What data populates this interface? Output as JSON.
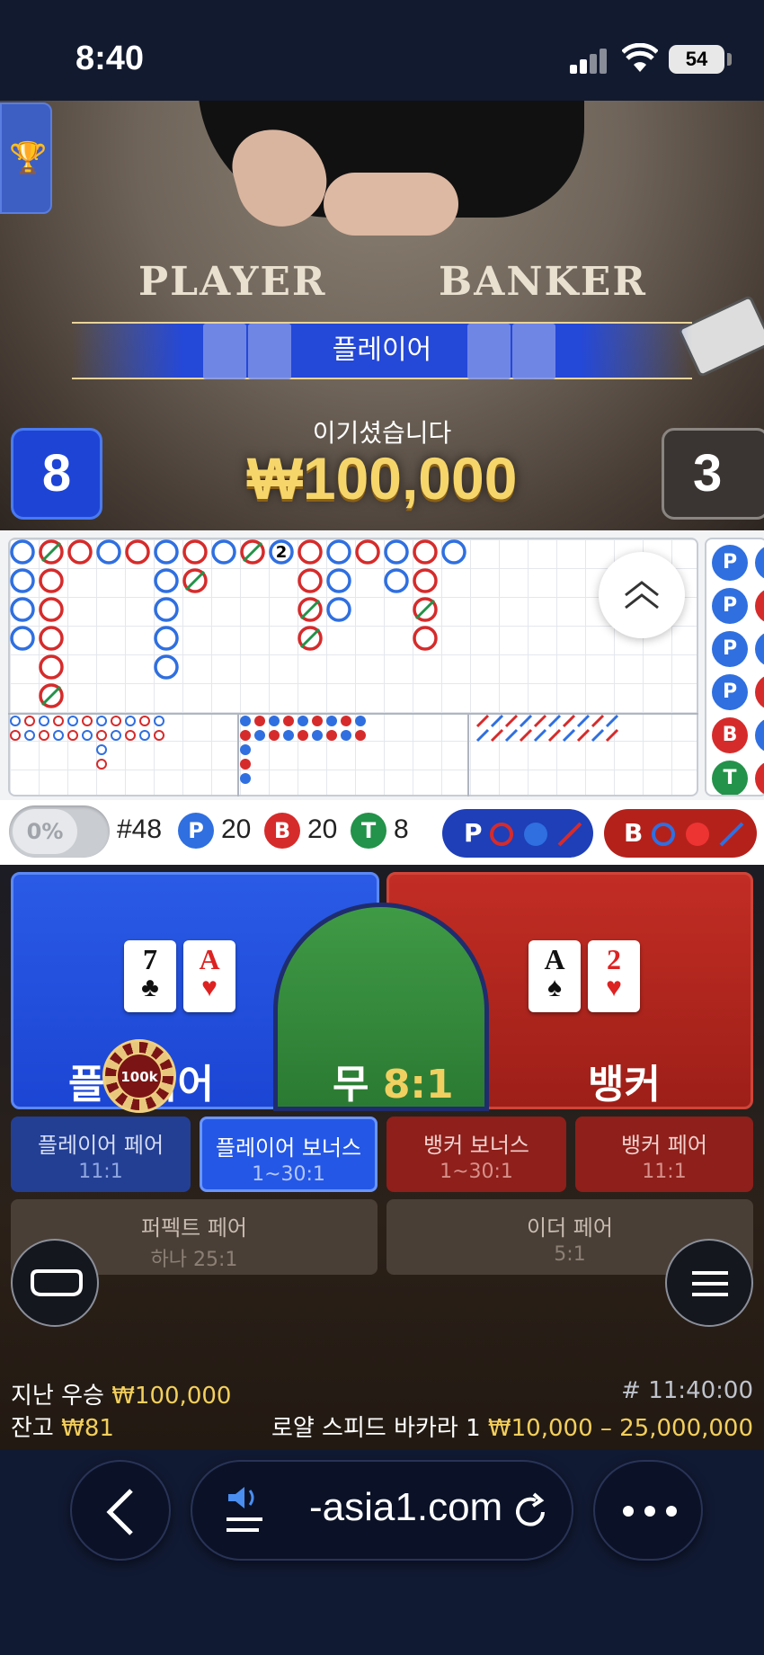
{
  "status": {
    "time": "8:40",
    "battery": "54"
  },
  "video": {
    "table_player_word": "PLAYER",
    "table_banker_word": "BANKER",
    "result_banner": "플레이어",
    "win_label": "이기셨습니다",
    "win_amount": "₩100,000",
    "player_score": "8",
    "banker_score": "3"
  },
  "roadmap": {
    "big_road_marker": "2",
    "side_beads": [
      "P",
      "P",
      "P",
      "P",
      "B",
      "T"
    ]
  },
  "stats": {
    "percent_toggle": "0%",
    "round": "#48",
    "player_count": "20",
    "banker_count": "20",
    "tie_count": "8",
    "p_label": "P",
    "b_label": "B",
    "t_label": "T",
    "colors": {
      "player": "#2f6fe0",
      "banker": "#d62b2b",
      "tie": "#23924a"
    }
  },
  "bets": {
    "player": {
      "label": "플레이어",
      "cards": [
        {
          "rank": "7",
          "suit": "♣"
        },
        {
          "rank": "A",
          "suit": "♥"
        }
      ]
    },
    "tie": {
      "label": "무",
      "odds": "8:1"
    },
    "banker": {
      "label": "뱅커",
      "cards": [
        {
          "rank": "A",
          "suit": "♠"
        },
        {
          "rank": "2",
          "suit": "♥"
        }
      ]
    },
    "chip": "100k",
    "side": [
      {
        "title": "플레이어 페어",
        "odds": "11:1"
      },
      {
        "title": "플레이어 보너스",
        "odds": "1~30:1"
      },
      {
        "title": "뱅커 보너스",
        "odds": "1~30:1"
      },
      {
        "title": "뱅커 페어",
        "odds": "11:1"
      },
      {
        "title": "퍼펙트 페어",
        "odds": "하나 25:1"
      },
      {
        "title": "이더 페어",
        "odds": "5:1"
      }
    ]
  },
  "footer": {
    "last_win_label": "지난 우승",
    "last_win_value": "₩100,000",
    "balance_label": "잔고",
    "balance_value": "₩81",
    "round_id": "# 11:40:00",
    "table_name": "로얄 스피드 바카라 1",
    "limits": "₩10,000 – 25,000,000"
  },
  "browser": {
    "url": "-asia1.com"
  }
}
